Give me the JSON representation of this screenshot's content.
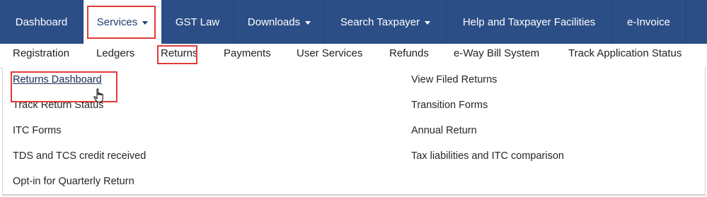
{
  "topnav": {
    "items": [
      {
        "label": "Dashboard",
        "dropdown": false
      },
      {
        "label": "Services",
        "dropdown": true
      },
      {
        "label": "GST Law",
        "dropdown": false
      },
      {
        "label": "Downloads",
        "dropdown": true
      },
      {
        "label": "Search Taxpayer",
        "dropdown": true
      },
      {
        "label": "Help and Taxpayer Facilities",
        "dropdown": false
      },
      {
        "label": "e-Invoice",
        "dropdown": false
      }
    ]
  },
  "subnav": {
    "items": [
      "Registration",
      "Ledgers",
      "Returns",
      "Payments",
      "User Services",
      "Refunds",
      "e-Way Bill System",
      "Track Application Status"
    ]
  },
  "returns_menu": {
    "left": [
      "Returns Dashboard",
      "Track Return Status",
      "ITC Forms",
      "TDS and TCS credit received",
      "Opt-in for Quarterly Return"
    ],
    "right": [
      "View Filed Returns",
      "Transition Forms",
      "Annual Return",
      "Tax liabilities and ITC comparison"
    ]
  },
  "colors": {
    "nav_bg": "#2c4e86",
    "highlight": "#e23b3b"
  }
}
